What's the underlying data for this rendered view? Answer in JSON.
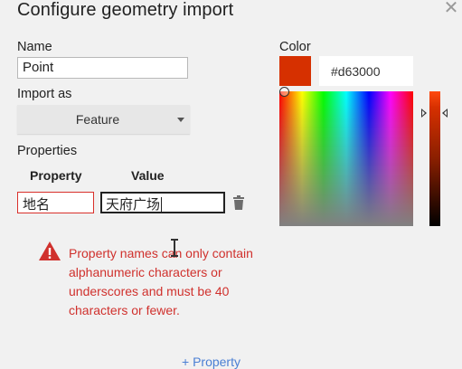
{
  "dialog": {
    "title": "Configure geometry import",
    "close_icon": "close-icon"
  },
  "form": {
    "name_label": "Name",
    "name_value": "Point",
    "import_as_label": "Import as",
    "import_as_value": "Feature",
    "properties_label": "Properties",
    "property_header": "Property",
    "value_header": "Value",
    "property_key": "地名",
    "property_value": "天府广场",
    "delete_icon": "trash-icon",
    "error_icon": "warning-icon",
    "error_message": "Property names can only contain alphanumeric characters or underscores and must be 40 characters or fewer.",
    "add_property": "+ Property"
  },
  "color": {
    "label": "Color",
    "hex": "#d63000",
    "swatch": "#d63000"
  },
  "colors": {
    "error": "#d0312d",
    "link": "#4a7fd4"
  }
}
